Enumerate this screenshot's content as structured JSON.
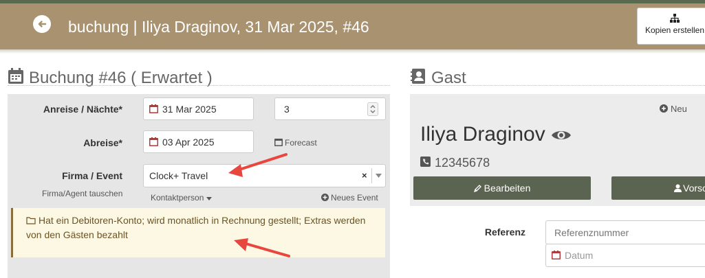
{
  "header": {
    "title": "buchung | Iliya Draginov, 31 Mar 2025, #46",
    "copy_button_label": "Kopien erstellen"
  },
  "booking": {
    "section_title": "Buchung #46 ( Erwartet )",
    "arrival_label": "Anreise / Nächte*",
    "arrival_date": "31 Mar 2025",
    "nights": "3",
    "departure_label": "Abreise*",
    "departure_date": "03 Apr 2025",
    "forecast_link": "Forecast",
    "company_label": "Firma / Event",
    "company_value": "Clock+ Travel",
    "swap_agent_link": "Firma/Agent tauschen",
    "contact_person_link": "Kontaktperson",
    "new_event_link": "Neues Event",
    "alert_text": "Hat ein Debitoren-Konto; wird monatlich in Rechnung gestellt; Extras werden von den Gästen bezahlt"
  },
  "guest": {
    "section_title": "Gast",
    "new_link": "Neu",
    "name": "Iliya Draginov",
    "phone": "12345678",
    "edit_button": "Bearbeiten",
    "second_button": "Vorsc",
    "reference_label": "Referenz",
    "reference_placeholder": "Referenznummer",
    "date_placeholder": "Datum"
  },
  "colors": {
    "header_bg": "#a89270",
    "button_dark": "#5b6450",
    "alert_bg": "#fcf8e3",
    "arrow": "#e8463f"
  }
}
